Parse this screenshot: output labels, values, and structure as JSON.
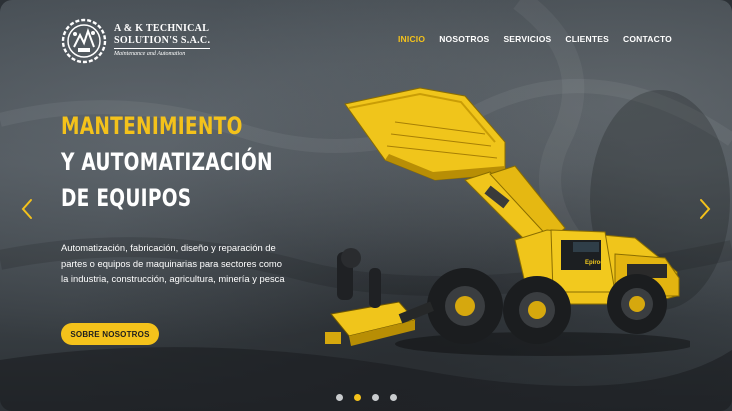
{
  "logo": {
    "line1": "A & K TECHNICAL",
    "line2": "SOLUTION'S S.A.C.",
    "line3": "Maintenance and Automation"
  },
  "nav": {
    "items": [
      {
        "label": "INICIO",
        "active": true
      },
      {
        "label": "NOSOTROS",
        "active": false
      },
      {
        "label": "SERVICIOS",
        "active": false
      },
      {
        "label": "CLIENTES",
        "active": false
      },
      {
        "label": "CONTACTO",
        "active": false
      }
    ]
  },
  "hero": {
    "title_line1": "MANTENIMIENTO",
    "title_line2": "Y AUTOMATIZACIÓN",
    "title_line3": "DE EQUIPOS",
    "description": "Automatización, fabricación, diseño y reparación de partes o equipos de maquinarias para sectores como la industria, construcción, agricultura, minería y pesca",
    "cta_label": "SOBRE NOSOTROS",
    "machine_brand": "Epiroc"
  },
  "slider": {
    "slide_count": 4,
    "active_index": 1,
    "prev_icon": "chevron-left-icon",
    "next_icon": "chevron-right-icon"
  },
  "colors": {
    "accent": "#f4c21b",
    "text": "#ffffff",
    "background": "#3f464c"
  }
}
